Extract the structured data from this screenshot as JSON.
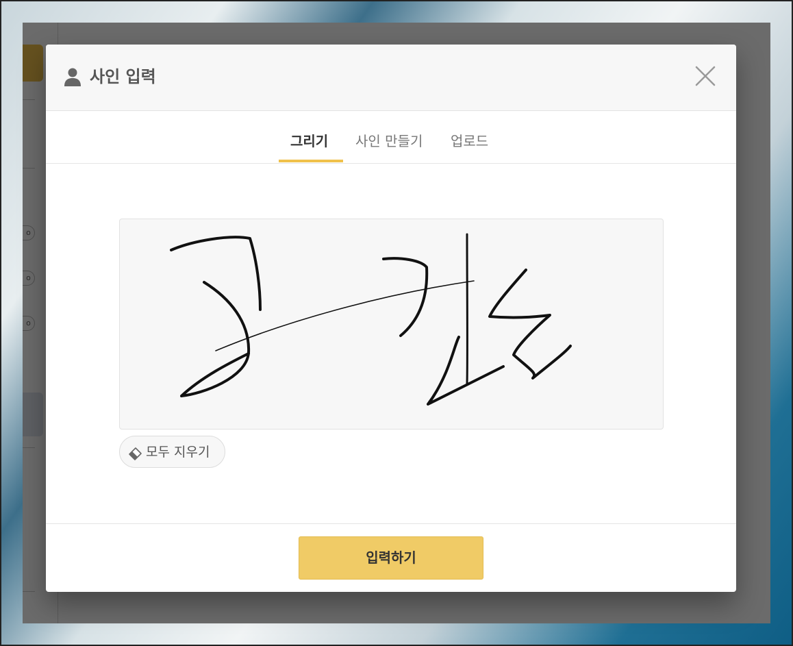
{
  "modal": {
    "title": "사인 입력",
    "icons": {
      "title": "user-icon",
      "close": "close-icon"
    }
  },
  "tabs": [
    {
      "label": "그리기",
      "active": true
    },
    {
      "label": "사인 만들기",
      "active": false
    },
    {
      "label": "업로드",
      "active": false
    }
  ],
  "canvas": {
    "has_signature": true
  },
  "clear_button": {
    "label": "모두 지우기",
    "icon": "eraser-icon"
  },
  "submit_button": {
    "label": "입력하기"
  },
  "colors": {
    "accent": "#f0c14b",
    "submit_bg": "#f0cb66",
    "overlay": "rgba(0,0,0,0.58)",
    "header_bg": "#f7f7f7"
  },
  "background_app": {
    "radio_glyphs": [
      "o",
      "o",
      "o"
    ]
  }
}
